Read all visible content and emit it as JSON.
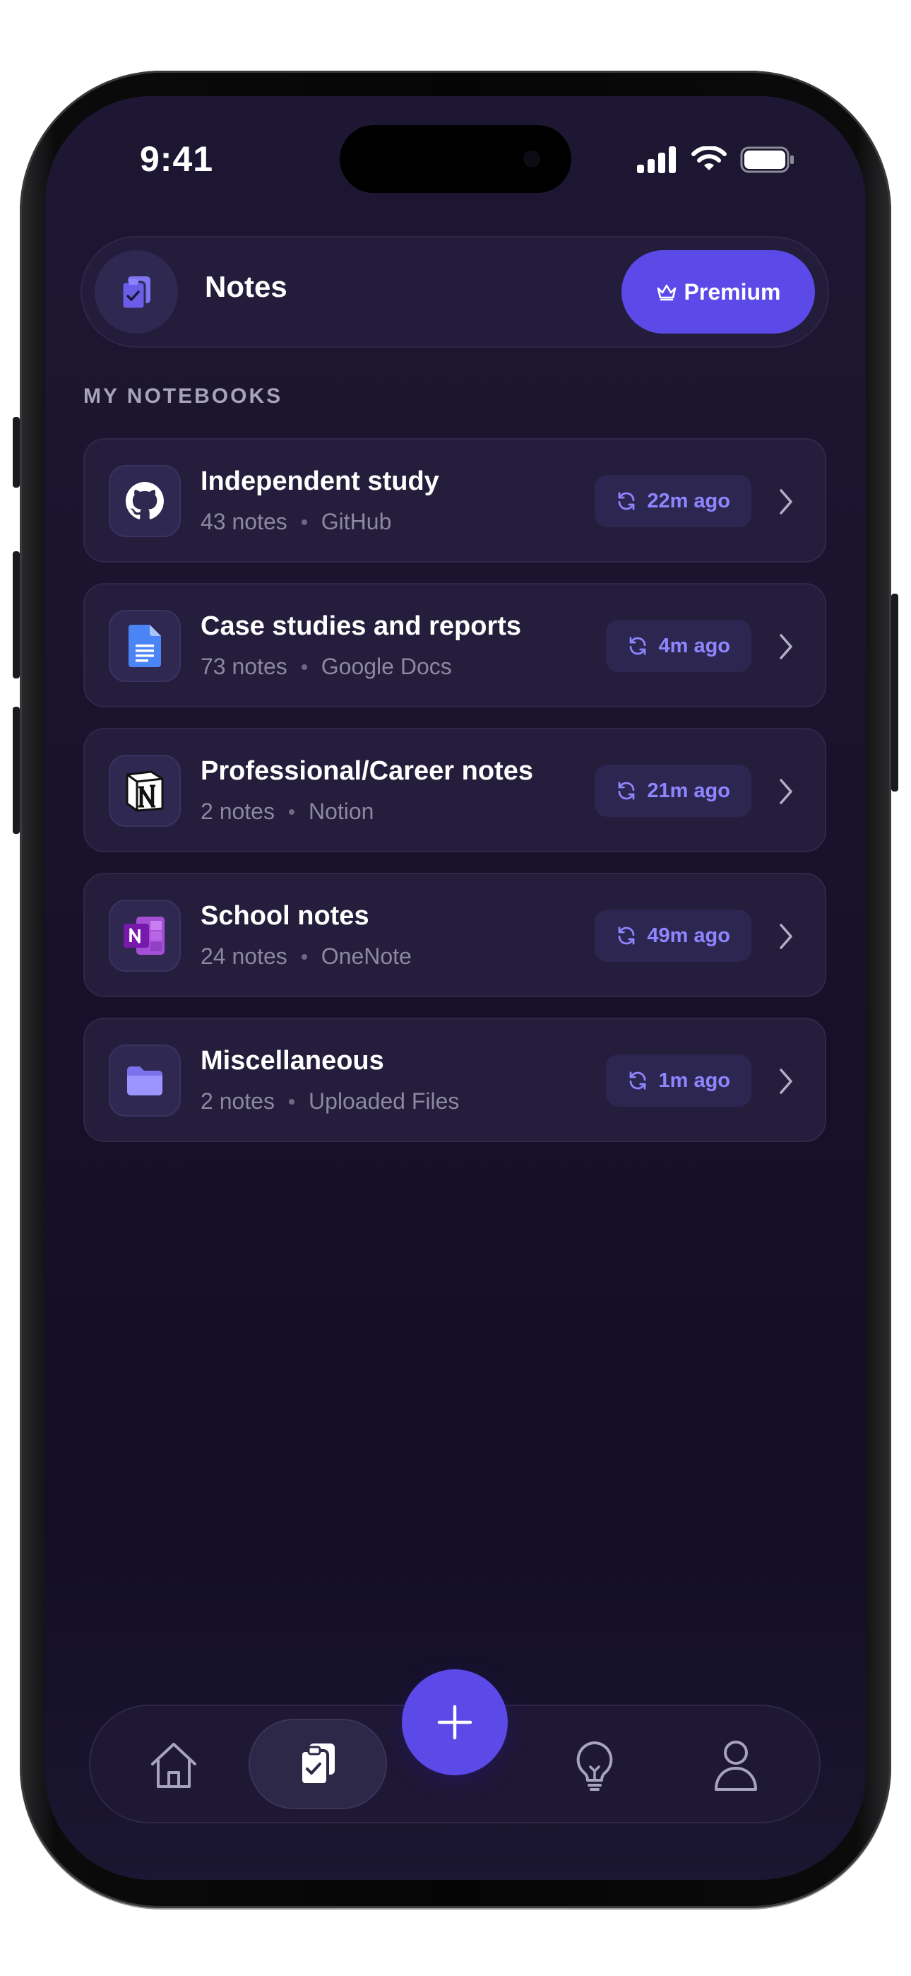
{
  "status_bar": {
    "time": "9:41"
  },
  "header": {
    "title": "Notes",
    "premium_label": "Premium",
    "icon": "clipboard-check-icon"
  },
  "section": {
    "label": "MY NOTEBOOKS"
  },
  "notebooks": [
    {
      "title": "Independent study",
      "count": "43 notes",
      "source": "GitHub",
      "synced": "22m ago",
      "icon": "github-icon"
    },
    {
      "title": "Case studies and reports",
      "count": "73 notes",
      "source": "Google Docs",
      "synced": "4m ago",
      "icon": "google-docs-icon"
    },
    {
      "title": "Professional/Career notes",
      "count": "2 notes",
      "source": "Notion",
      "synced": "21m ago",
      "icon": "notion-icon"
    },
    {
      "title": "School notes",
      "count": "24 notes",
      "source": "OneNote",
      "synced": "49m ago",
      "icon": "onenote-icon"
    },
    {
      "title": "Miscellaneous",
      "count": "2 notes",
      "source": "Uploaded Files",
      "synced": "1m ago",
      "icon": "folder-icon"
    }
  ],
  "tabbar": {
    "tabs": [
      {
        "name": "home",
        "icon": "home-icon",
        "active": false
      },
      {
        "name": "notes",
        "icon": "clipboard-check-icon",
        "active": true
      },
      {
        "name": "ideas",
        "icon": "lightbulb-icon",
        "active": false
      },
      {
        "name": "profile",
        "icon": "user-icon",
        "active": false
      }
    ],
    "fab_icon": "plus-icon"
  },
  "colors": {
    "accent": "#5b49e8",
    "sync_text": "#8f86ff",
    "background": "#161029"
  }
}
